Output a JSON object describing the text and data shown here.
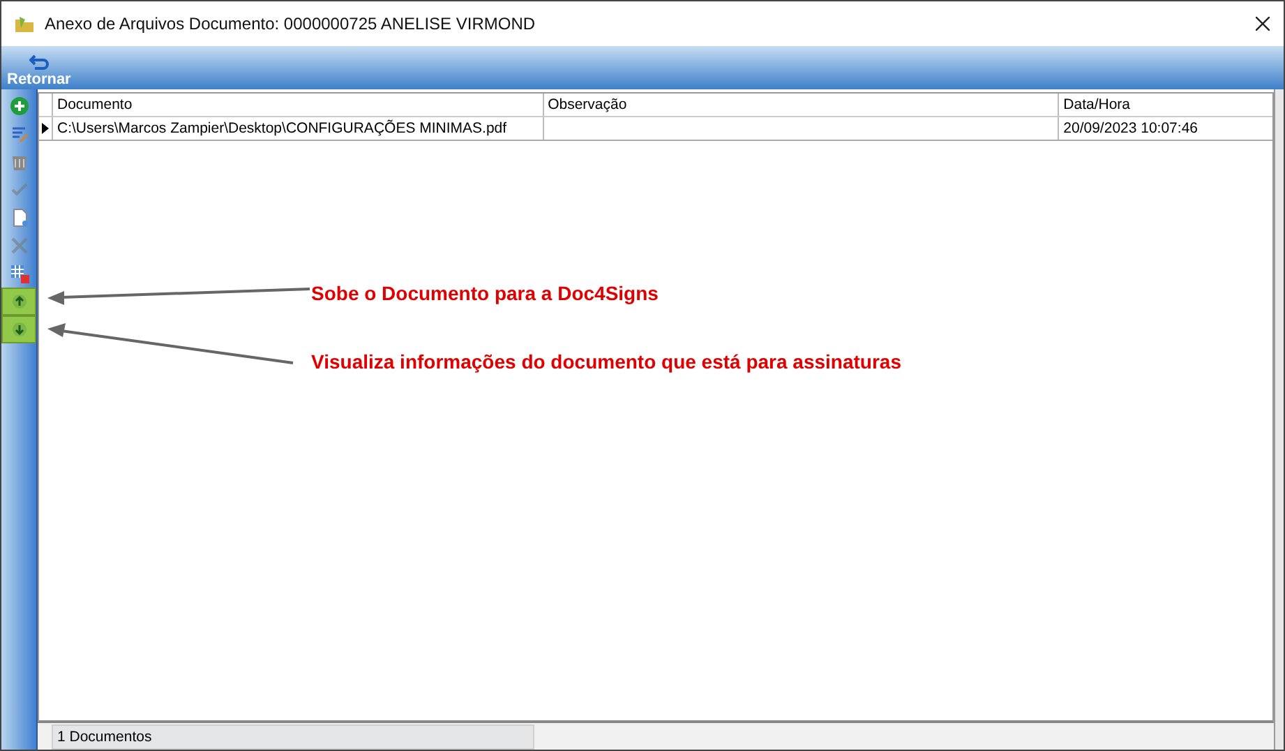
{
  "window": {
    "title": "Anexo de Arquivos Documento: 0000000725 ANELISE VIRMOND"
  },
  "toolbar": {
    "buttons": [
      {
        "label": "Retornar"
      }
    ]
  },
  "sidebar": {
    "tools": [
      {
        "kind": "add",
        "disabled": false,
        "highlighted": false
      },
      {
        "kind": "edit",
        "disabled": false,
        "highlighted": false
      },
      {
        "kind": "trash",
        "disabled": false,
        "highlighted": false
      },
      {
        "kind": "check",
        "disabled": true,
        "highlighted": false
      },
      {
        "kind": "document",
        "disabled": false,
        "highlighted": false
      },
      {
        "kind": "cross",
        "disabled": true,
        "highlighted": false
      },
      {
        "kind": "grid",
        "disabled": false,
        "highlighted": false
      },
      {
        "kind": "upload",
        "disabled": false,
        "highlighted": true
      },
      {
        "kind": "download",
        "disabled": false,
        "highlighted": true
      }
    ]
  },
  "table": {
    "columns": [
      "Documento",
      "Observação",
      "Data/Hora"
    ],
    "rows": [
      {
        "current": true,
        "cells": [
          "C:\\Users\\Marcos Zampier\\Desktop\\CONFIGURAÇÕES MINIMAS.pdf",
          "",
          "20/09/2023 10:07:46"
        ]
      }
    ]
  },
  "status_bar": {
    "text": "1 Documentos"
  },
  "annotations": [
    {
      "text": "Sobe o Documento para a Doc4Signs"
    },
    {
      "text": "Visualiza informações do documento que está para assinaturas"
    }
  ]
}
